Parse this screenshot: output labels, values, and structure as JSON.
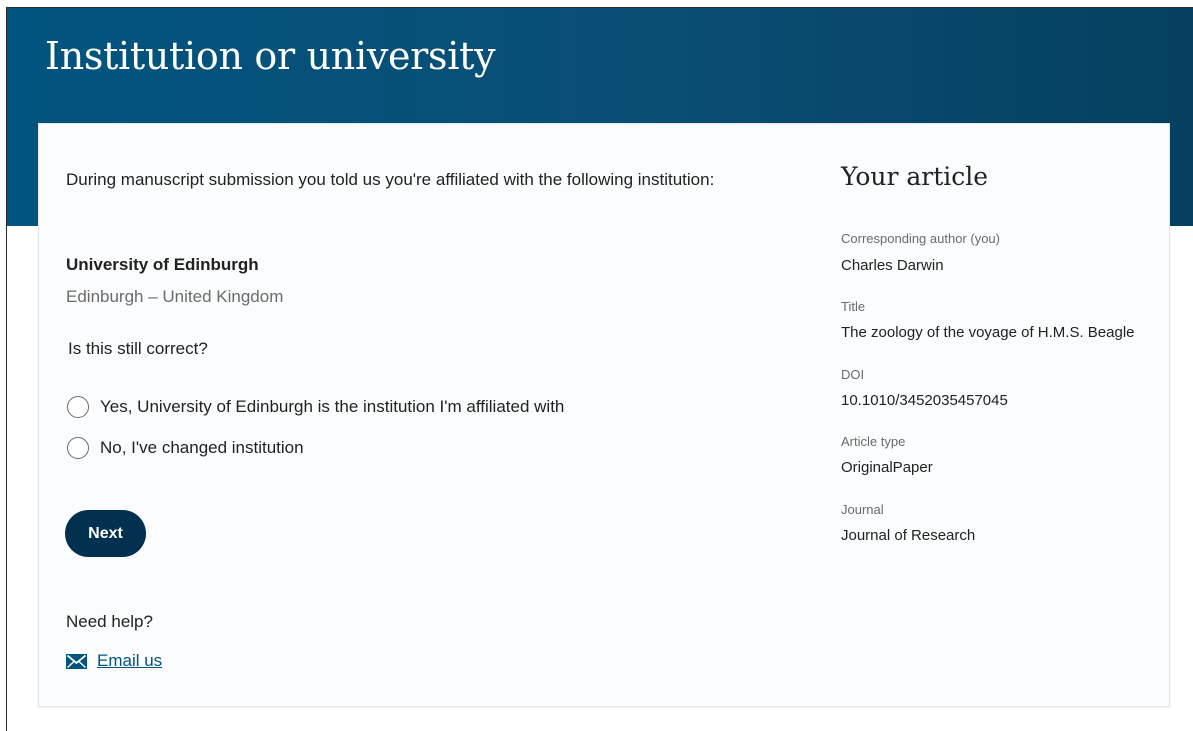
{
  "header": {
    "title": "Institution or university"
  },
  "main": {
    "intro": "During manuscript submission you told us you're affiliated with the following institution:",
    "institution_name": "University of Edinburgh",
    "institution_location": "Edinburgh – United Kingdom",
    "question": "Is this still correct?",
    "options": [
      {
        "label": "Yes, University of Edinburgh is the institution I'm affiliated with",
        "selected": false
      },
      {
        "label": "No, I've changed institution",
        "selected": false
      }
    ],
    "next_label": "Next",
    "help_title": "Need help?",
    "email_label": "Email us",
    "email_icon": "mail-icon"
  },
  "aside": {
    "title": "Your article",
    "items": [
      {
        "label": "Corresponding author (you)",
        "value": "Charles Darwin"
      },
      {
        "label": "Title",
        "value": "The zoology of the voyage of H.M.S. Beagle"
      },
      {
        "label": "DOI",
        "value": "10.1010/3452035457045"
      },
      {
        "label": "Article type",
        "value": "OriginalPaper"
      },
      {
        "label": "Journal",
        "value": "Journal of Research"
      }
    ]
  },
  "colors": {
    "header_band": "#01547f",
    "primary_button": "#02304f",
    "link": "#01547f"
  }
}
